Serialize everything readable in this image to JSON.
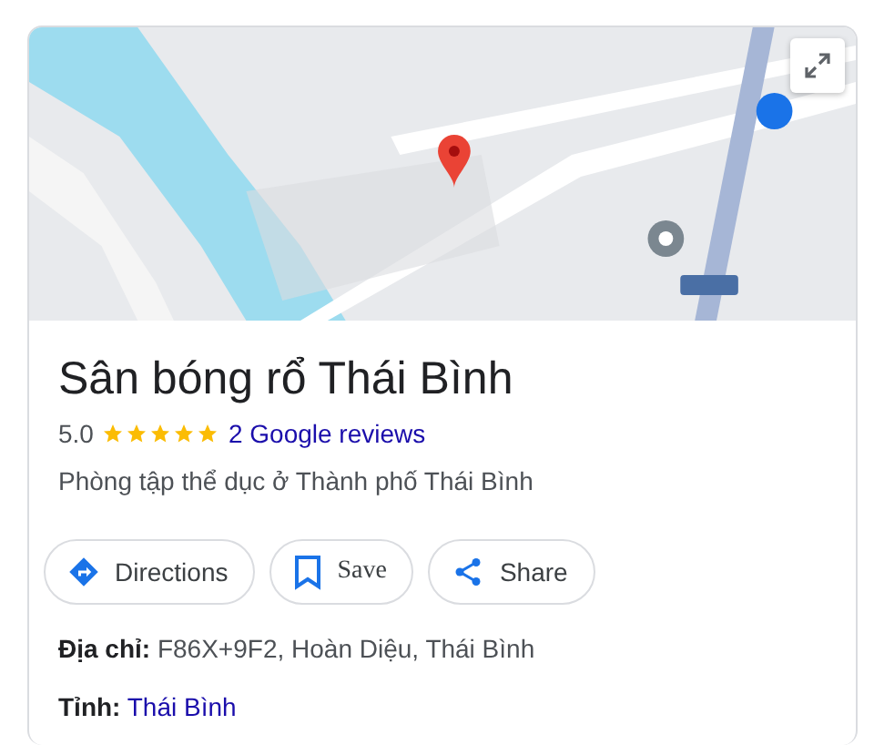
{
  "title": "Sân bóng rổ Thái Bình",
  "rating": {
    "score": "5.0",
    "stars": 5,
    "reviews_link": "2 Google reviews"
  },
  "category": "Phòng tập thể dục ở Thành phố Thái Bình",
  "actions": [
    {
      "kind": "directions",
      "label": "Directions"
    },
    {
      "kind": "save",
      "label": "Save"
    },
    {
      "kind": "share",
      "label": "Share"
    }
  ],
  "details": [
    {
      "label": "Địa chỉ:",
      "value": "F86X+9F2, Hoàn Diệu, Thái Bình",
      "link": false
    },
    {
      "label": "Tỉnh:",
      "value": "Thái Bình",
      "link": true
    }
  ]
}
